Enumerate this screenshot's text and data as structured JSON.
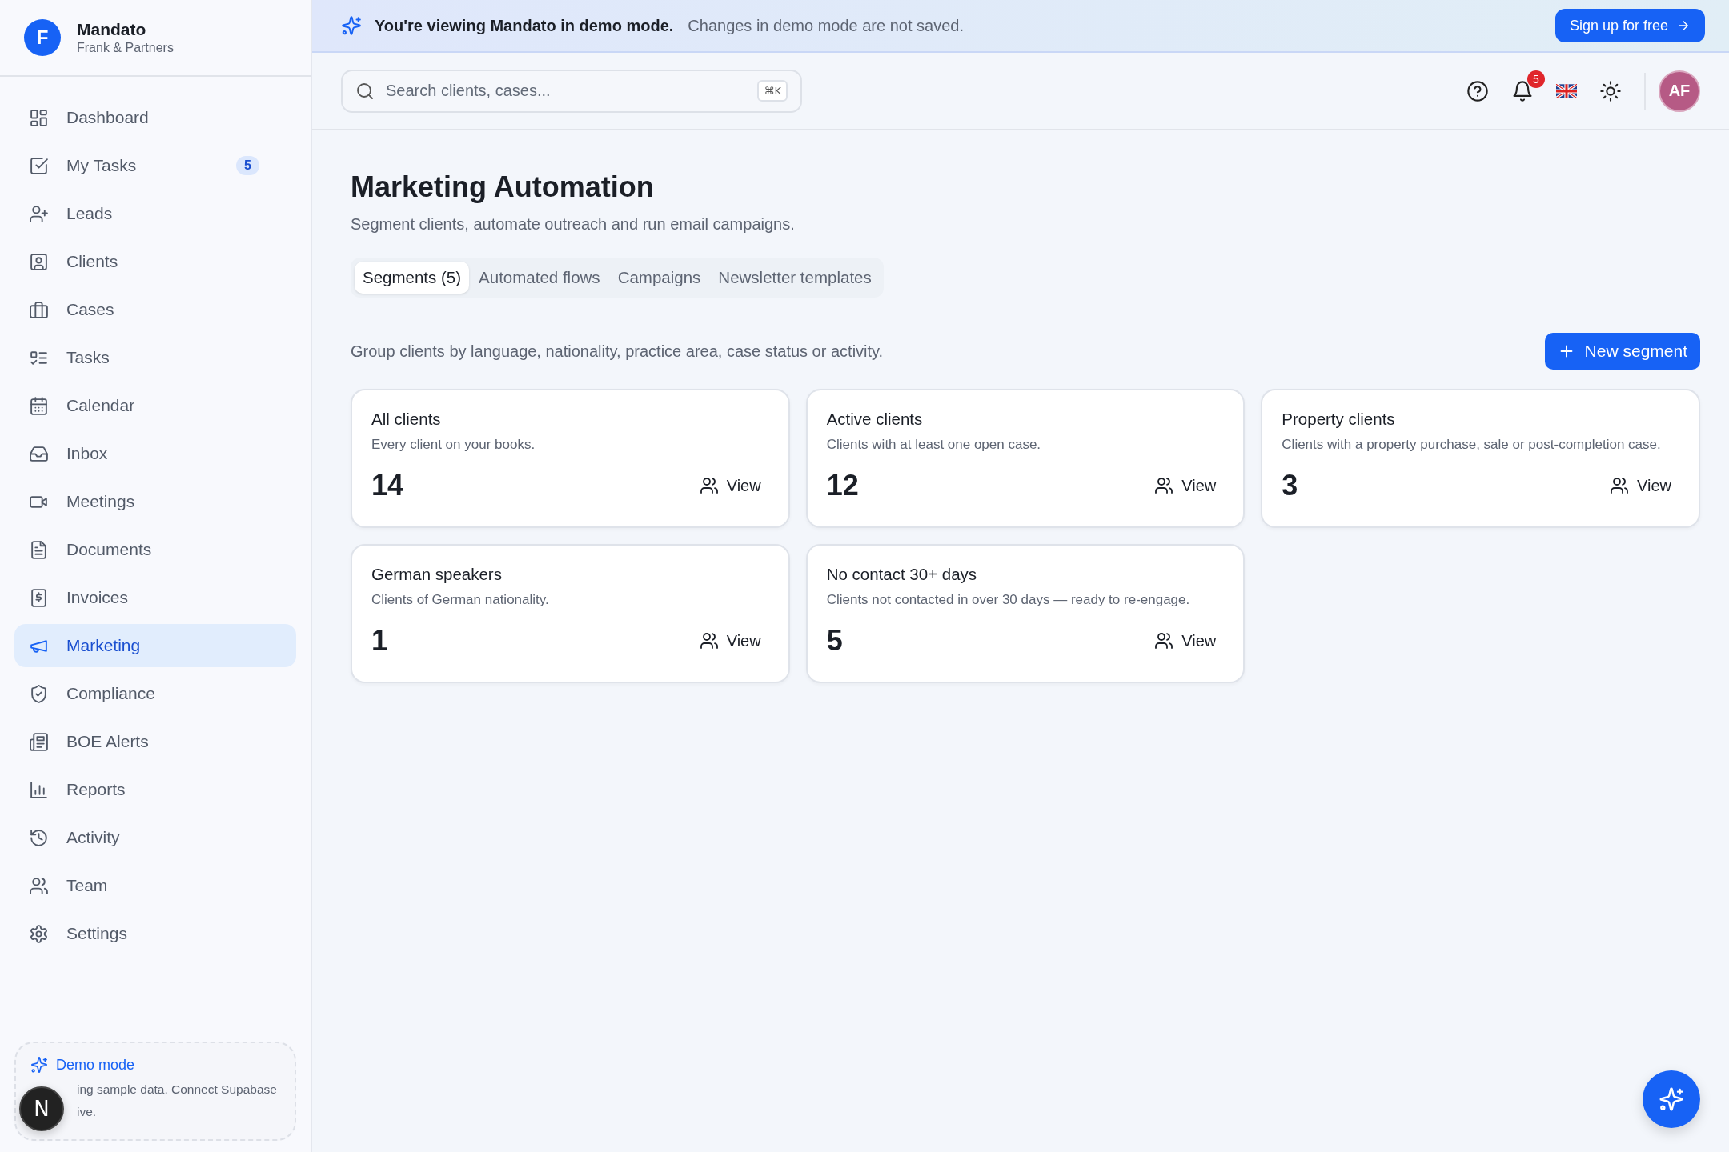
{
  "brand": {
    "initial": "F",
    "name": "Mandato",
    "org": "Frank & Partners"
  },
  "sidebar": {
    "items": [
      {
        "label": "Dashboard",
        "selected": false
      },
      {
        "label": "My Tasks",
        "selected": false,
        "badge": "5"
      },
      {
        "label": "Leads",
        "selected": false
      },
      {
        "label": "Clients",
        "selected": false
      },
      {
        "label": "Cases",
        "selected": false
      },
      {
        "label": "Tasks",
        "selected": false
      },
      {
        "label": "Calendar",
        "selected": false
      },
      {
        "label": "Inbox",
        "selected": false
      },
      {
        "label": "Meetings",
        "selected": false
      },
      {
        "label": "Documents",
        "selected": false
      },
      {
        "label": "Invoices",
        "selected": false
      },
      {
        "label": "Marketing",
        "selected": true
      },
      {
        "label": "Compliance",
        "selected": false
      },
      {
        "label": "BOE Alerts",
        "selected": false
      },
      {
        "label": "Reports",
        "selected": false
      },
      {
        "label": "Activity",
        "selected": false
      },
      {
        "label": "Team",
        "selected": false
      },
      {
        "label": "Settings",
        "selected": false
      }
    ],
    "demo_card": {
      "title": "Demo mode",
      "text_line_1": "ing sample data. Connect Supabase",
      "text_line_2": "ive."
    },
    "dev_badge": "N"
  },
  "banner": {
    "title": "You're viewing Mandato in demo mode.",
    "text": "Changes in demo mode are not saved.",
    "button": "Sign up for free"
  },
  "topbar": {
    "search": {
      "placeholder": "Search clients, cases..."
    },
    "shortcut": "⌘K",
    "notifications": "5",
    "avatar": "AF"
  },
  "page": {
    "title": "Marketing Automation",
    "subtitle": "Segment clients, automate outreach and run email campaigns.",
    "tabs": [
      {
        "label": "Segments (5)",
        "selected": true
      },
      {
        "label": "Automated flows",
        "selected": false
      },
      {
        "label": "Campaigns",
        "selected": false
      },
      {
        "label": "Newsletter templates",
        "selected": false
      }
    ],
    "description": "Group clients by language, nationality, practice area, case status or activity.",
    "new_button": "New segment",
    "segments": [
      {
        "name": "All clients",
        "description": "Every client on your books.",
        "count": "14",
        "action": "View"
      },
      {
        "name": "Active clients",
        "description": "Clients with at least one open case.",
        "count": "12",
        "action": "View"
      },
      {
        "name": "Property clients",
        "description": "Clients with a property purchase, sale or post-completion case.",
        "count": "3",
        "action": "View"
      },
      {
        "name": "German speakers",
        "description": "Clients of German nationality.",
        "count": "1",
        "action": "View"
      },
      {
        "name": "No contact 30+ days",
        "description": "Clients not contacted in over 30 days — ready to re-engage.",
        "count": "5",
        "action": "View"
      }
    ]
  }
}
